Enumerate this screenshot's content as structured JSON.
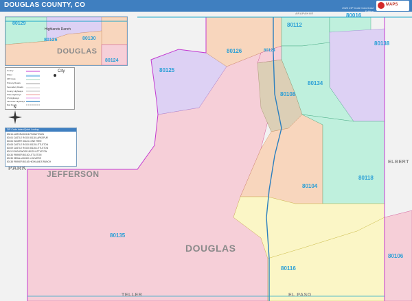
{
  "header": {
    "title": "DOUGLAS COUNTY, CO",
    "edition": "2022 ZIP Code ColorCast Edition",
    "logo_text": "MAPS"
  },
  "counties": {
    "douglas_main": "DOUGLAS",
    "douglas_inset": "DOUGLAS",
    "jefferson": "JEFFERSON",
    "park": "PARK",
    "elbert": "ELBERT",
    "teller": "TELLER",
    "el_paso": "EL PASO",
    "arapahoe": "ARAPAHOE"
  },
  "zip_labels": {
    "z80016": "80016",
    "z80112": "80112",
    "z80138": "80138",
    "z80126": "80126",
    "z80124": "80124",
    "z80125": "80125",
    "z80108": "80108",
    "z80134": "80134",
    "z80104": "80104",
    "z80118": "80118",
    "z80135": "80135",
    "z80116": "80116",
    "z80106": "80106"
  },
  "inset": {
    "place": "Highlands Ranch",
    "zips": [
      "80129",
      "80126",
      "80130",
      "80124"
    ]
  },
  "legend": {
    "rows": [
      "County",
      "Water",
      "ZIP Code",
      "Primary Roads",
      "Secondary Roads",
      "County Highways",
      "State Highways",
      "US Highways",
      "Interstate Highways",
      "Rail Roads"
    ],
    "city_label": "City"
  },
  "compass": {
    "north": "N"
  },
  "zip_table": {
    "title": "ZIP Code Index/Quick Lookup",
    "rows": [
      [
        "80016",
        "AURORA",
        "80116",
        "FRANKTOWN"
      ],
      [
        "80104",
        "CASTLE ROCK",
        "80118",
        "LARKSPUR"
      ],
      [
        "80106",
        "ELBERT",
        "80124",
        "LONE TREE"
      ],
      [
        "80108",
        "CASTLE ROCK",
        "80125",
        "LITTLETON"
      ],
      [
        "80109",
        "CASTLE ROCK",
        "80126",
        "LITTLETON"
      ],
      [
        "80112",
        "ENGLEWOOD",
        "80129",
        "LITTLETON"
      ],
      [
        "80134",
        "PARKER",
        "80130",
        "LITTLETON"
      ],
      [
        "80135",
        "SEDALIA",
        "80131",
        "LOUVIERS"
      ],
      [
        "80138",
        "PARKER",
        "80163",
        "HIGHLANDS RANCH"
      ]
    ]
  },
  "colors": {
    "header": "#3f7fc0",
    "zip_text": "#2a9fd6",
    "county_line": "#c43bd1",
    "pink": "#f6cfd8",
    "green": "#bff0dd",
    "purple": "#ddd1f4",
    "orange": "#f8d6bd",
    "yellow": "#fbf6c6",
    "tan": "#dccfb6"
  }
}
